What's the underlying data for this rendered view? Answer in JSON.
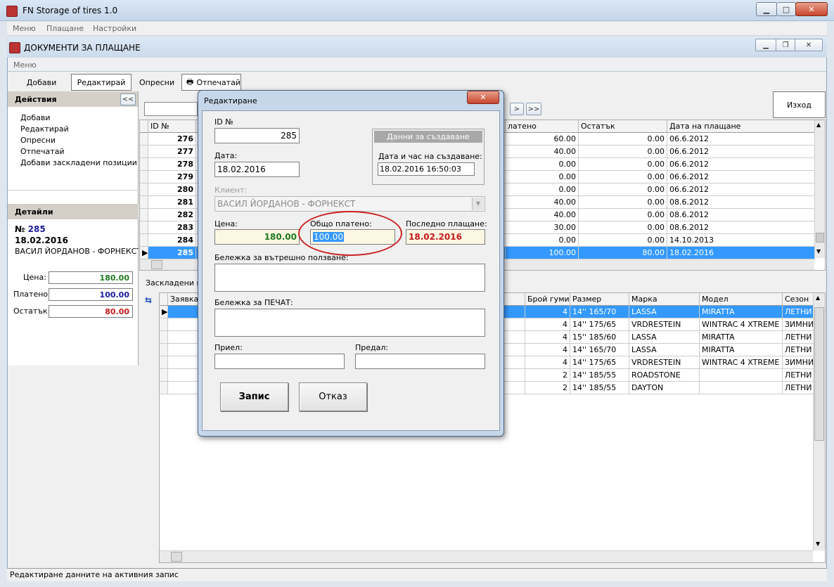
{
  "app": {
    "title": "FN Storage of tires 1.0",
    "menu": [
      "Меню",
      "Плащане",
      "Настройки"
    ]
  },
  "window": {
    "title": "ДОКУМЕНТИ ЗА ПЛАЩАНЕ",
    "menu": "Меню"
  },
  "toolbar": {
    "add": "Добави",
    "edit": "Редактирай",
    "refresh": "Опресни",
    "print": "Отпечатай",
    "exit": "Изход"
  },
  "actions": {
    "title": "Действия",
    "collapse": "<<",
    "items": [
      "Добави",
      "Редактирай",
      "Опресни",
      "Отпечатай",
      "Добави заскладени позиции"
    ]
  },
  "details": {
    "title": "Детайли",
    "no_prefix": "№",
    "no": "285",
    "date": "18.02.2016",
    "client": "ВАСИЛ ЙОРДАНОВ - ФОРНЕКСТ",
    "price_label": "Цена:",
    "price": "180.00",
    "paid_label": "Платено:",
    "paid": "100.00",
    "rest_label": "Остатък:",
    "rest": "80.00"
  },
  "top_grid": {
    "headers": {
      "id": "ID №",
      "paid": "латено",
      "rest": "Остатък",
      "date": "Дата на плащане"
    },
    "rows": [
      {
        "id": "276",
        "paid": "60.00",
        "rest": "0.00",
        "date": "06.6.2012"
      },
      {
        "id": "277",
        "paid": "40.00",
        "rest": "0.00",
        "date": "06.6.2012"
      },
      {
        "id": "278",
        "paid": "0.00",
        "rest": "0.00",
        "date": "06.6.2012"
      },
      {
        "id": "279",
        "paid": "0.00",
        "rest": "0.00",
        "date": "06.6.2012"
      },
      {
        "id": "280",
        "paid": "0.00",
        "rest": "0.00",
        "date": "06.6.2012"
      },
      {
        "id": "281",
        "paid": "40.00",
        "rest": "0.00",
        "date": "08.6.2012"
      },
      {
        "id": "282",
        "paid": "40.00",
        "rest": "0.00",
        "date": "08.6.2012"
      },
      {
        "id": "283",
        "paid": "30.00",
        "rest": "0.00",
        "date": "08.6.2012"
      },
      {
        "id": "284",
        "paid": "0.00",
        "rest": "0.00",
        "date": "14.10.2013"
      },
      {
        "id": "285",
        "paid": "100.00",
        "rest": "80.00",
        "date": "18.02.2016"
      }
    ],
    "nav_next": ">",
    "nav_last": ">>"
  },
  "stored": {
    "label": "Заскладени по",
    "headers": {
      "order": "Заявка",
      "count": "Брой гуми",
      "size": "Размер",
      "brand": "Марка",
      "model": "Модел",
      "season": "Сезон"
    },
    "rows": [
      {
        "count": "4",
        "size": "14'' 165/70",
        "brand": "LASSA",
        "model": "MIRATTA",
        "season": "ЛЕТНИ"
      },
      {
        "count": "4",
        "size": "14'' 175/65",
        "brand": "VRDRESTEIN",
        "model": "WINTRAC 4 XTREME",
        "season": "ЗИМНИ"
      },
      {
        "count": "4",
        "size": "15'' 185/60",
        "brand": "LASSA",
        "model": "MIRATTA",
        "season": "ЛЕТНИ"
      },
      {
        "count": "4",
        "size": "14'' 165/70",
        "brand": "LASSA",
        "model": "MIRATTA",
        "season": "ЛЕТНИ"
      },
      {
        "count": "4",
        "size": "14'' 175/65",
        "brand": "VRDRESTEIN",
        "model": "WINTRAC 4 XTREME",
        "season": "ЗИМНИ"
      },
      {
        "count": "2",
        "size": "14'' 185/55",
        "brand": "ROADSTONE",
        "model": "",
        "season": "ЛЕТНИ"
      },
      {
        "count": "2",
        "size": "14'' 185/55",
        "brand": "DAYTON",
        "model": "",
        "season": "ЛЕТНИ"
      }
    ]
  },
  "dialog": {
    "title": "Редактиране",
    "id_label": "ID №",
    "id": "285",
    "date_label": "Дата:",
    "date": "18.02.2016",
    "created_group": "Данни за създаване",
    "created_label": "Дата и час на създаване:",
    "created": "18.02.2016 16:50:03",
    "client_label": "Клиент:",
    "client": "ВАСИЛ ЙОРДАНОВ - ФОРНЕКСТ",
    "price_label": "Цена:",
    "price": "180.00",
    "total_label": "Общо платено:",
    "total": "100.00",
    "last_label": "Последно плащане:",
    "last": "18.02.2016",
    "note_internal_label": "Бележка за вътрешно ползване:",
    "note_print_label": "Бележка за ПЕЧАТ:",
    "received_label": "Приел:",
    "handed_label": "Предал:",
    "save": "Запис",
    "cancel": "Отказ",
    "close": "x"
  },
  "status": "Редактиране данните на активния запис",
  "colors": {
    "green": "#1e7a1e",
    "blue": "#1a1a9e",
    "red": "#c41a1a",
    "selected": "#3399ff",
    "highlight": "#cc2222"
  }
}
